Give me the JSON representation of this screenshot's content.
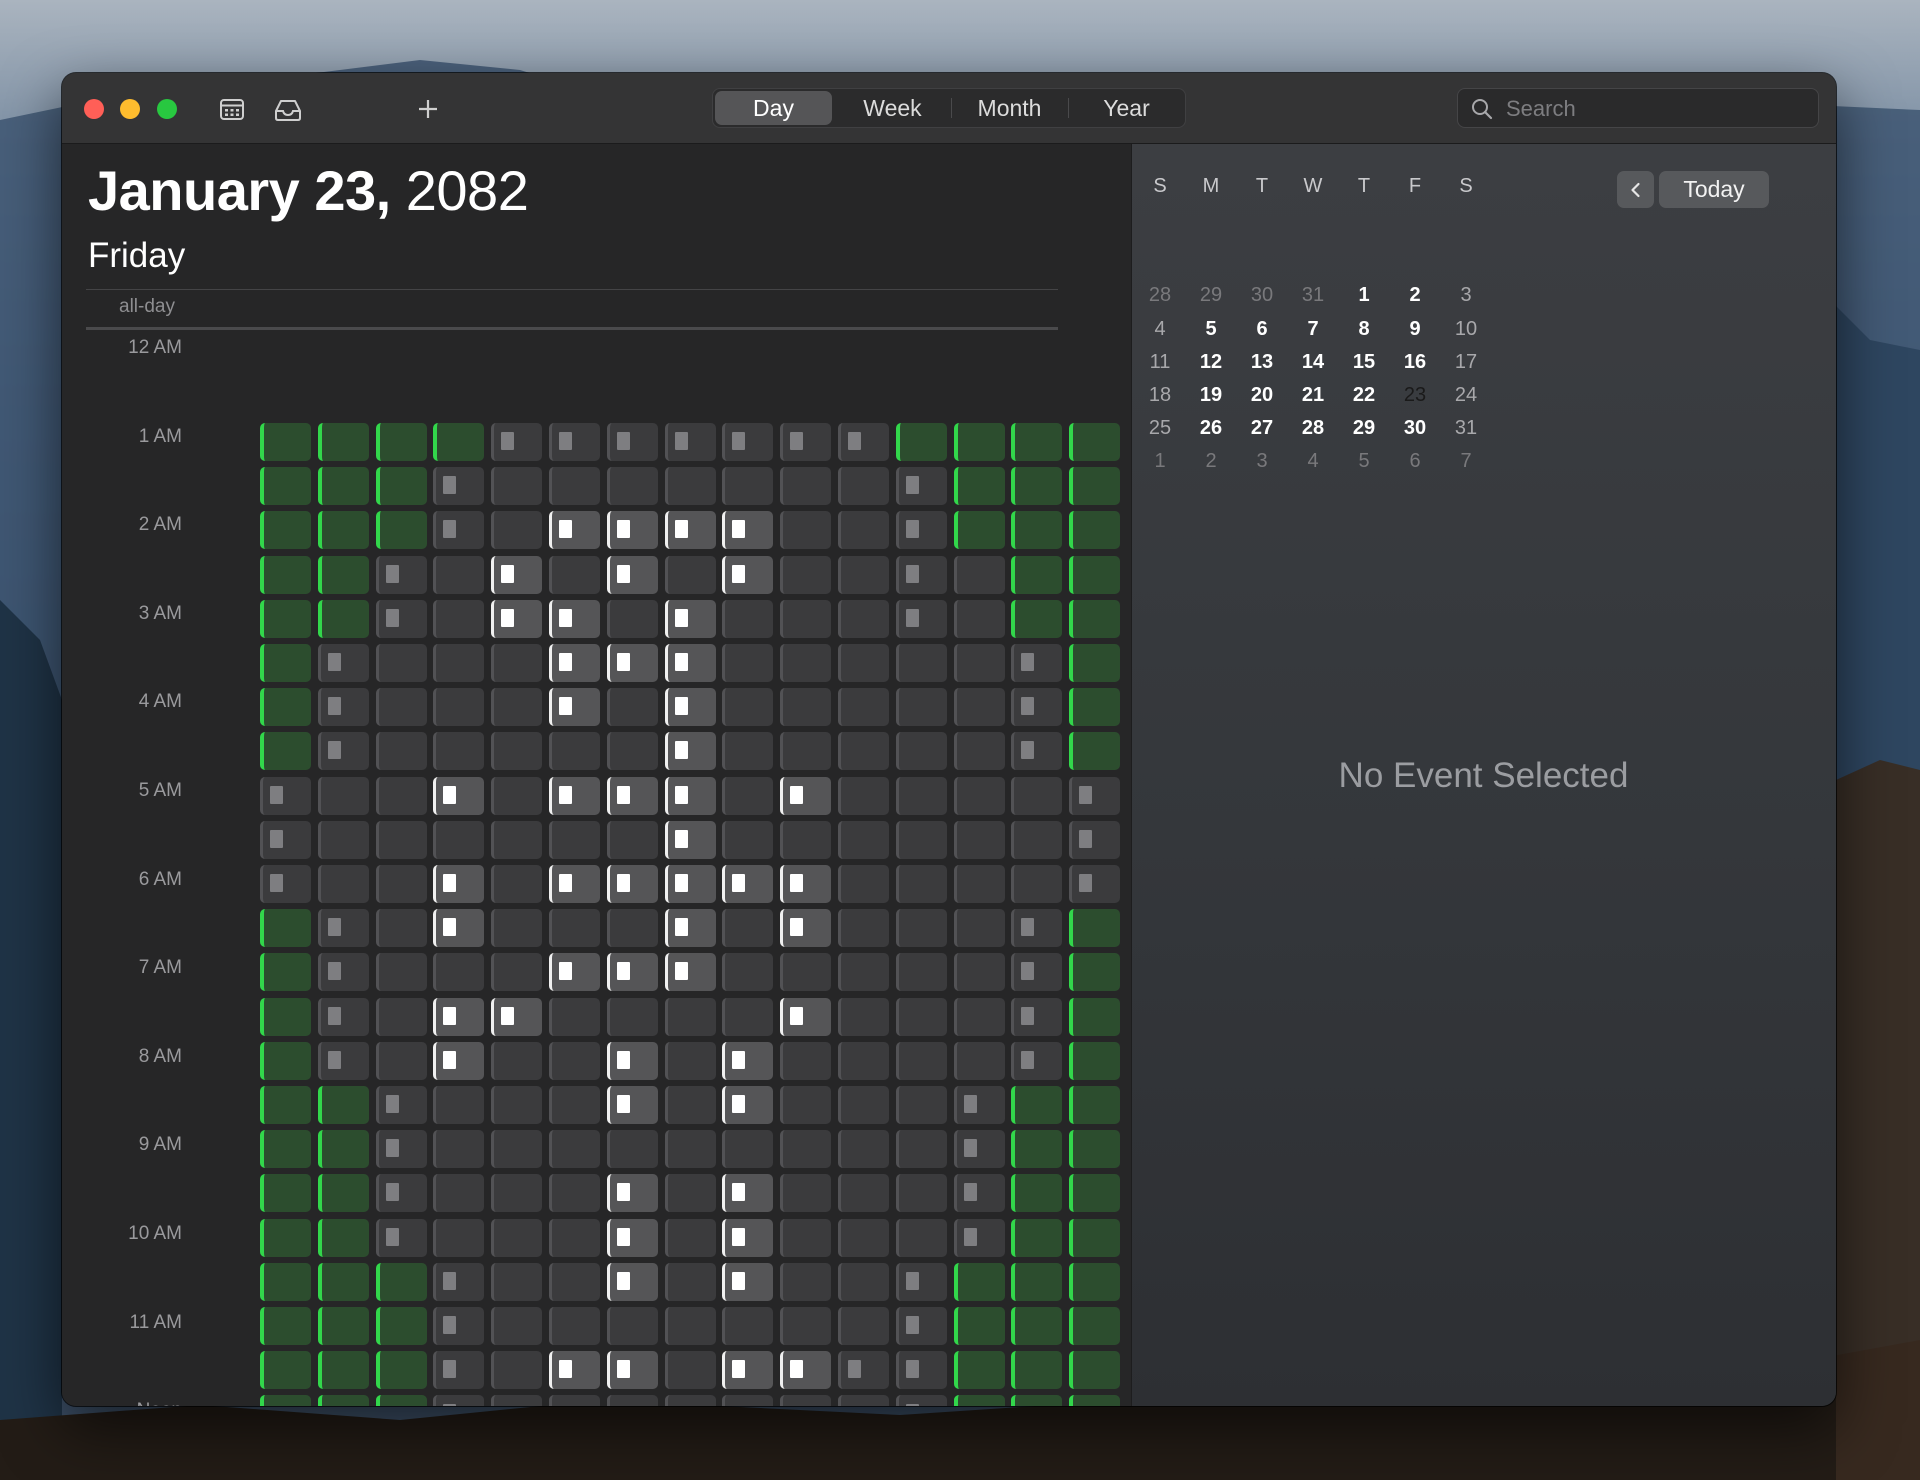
{
  "toolbar": {
    "segments": [
      "Day",
      "Week",
      "Month",
      "Year"
    ],
    "active_segment": "Day",
    "search_placeholder": "Search",
    "icons": [
      "calendar-list-icon",
      "inbox-icon",
      "plus-icon",
      "search-icon"
    ]
  },
  "day_view": {
    "month_day": "January 23,",
    "year": "2082",
    "weekday": "Friday",
    "allday_label": "all-day",
    "hour_labels": [
      "12 AM",
      "1 AM",
      "2 AM",
      "3 AM",
      "4 AM",
      "5 AM",
      "6 AM",
      "7 AM",
      "8 AM",
      "9 AM",
      "10 AM",
      "11 AM",
      "Noon"
    ],
    "event_legend": {
      "g": "green event",
      "d": "gray event with marker",
      "e": "gray event",
      "l": "highlighted event with white marker"
    },
    "event_rows": [
      "ggggdddddddgggg",
      "gggdeeeeeeedggg",
      "gggdelllleedggg",
      "ggdeleleleedegg",
      "ggdelleleeedegg",
      "gdeeellleeeeedg",
      "gdeeeleleeeeedg",
      "gdeeeeeleeeeedg",
      "deelellleleeeed",
      "deeeeeeleeeeeed",
      "deelellllleeeed",
      "gdeleeeleleeedg",
      "gdeeellleeeeedg",
      "gdelleeeeleeedg",
      "gdeleeleleeeedg",
      "ggdeeeleleeedgg",
      "ggdeeeeeeeeedgg",
      "ggdeeeleleeedgg",
      "ggdeeeleleeedgg",
      "gggdeeleleedggg",
      "gggdeeeeeeedggg",
      "gggdellellddggg",
      "gggdeeeeeeedggg",
      "ggggdddddddgggg"
    ]
  },
  "mini_calendar": {
    "weekday_headers": [
      "S",
      "M",
      "T",
      "W",
      "T",
      "F",
      "S"
    ],
    "weeks": [
      [
        "28",
        "29",
        "30",
        "31",
        "1",
        "2",
        "3"
      ],
      [
        "4",
        "5",
        "6",
        "7",
        "8",
        "9",
        "10"
      ],
      [
        "11",
        "12",
        "13",
        "14",
        "15",
        "16",
        "17"
      ],
      [
        "18",
        "19",
        "20",
        "21",
        "22",
        "23",
        "24"
      ],
      [
        "25",
        "26",
        "27",
        "28",
        "29",
        "30",
        "31"
      ],
      [
        "1",
        "2",
        "3",
        "4",
        "5",
        "6",
        "7"
      ]
    ],
    "selected": "23",
    "today_label": "Today"
  },
  "inspector": {
    "empty_text": "No Event Selected"
  },
  "colors": {
    "event_green": "#32d74b",
    "event_green_fill": "#2c4d2e",
    "event_gray_fill": "#3b3b3d",
    "event_highlight_fill": "#555557"
  }
}
